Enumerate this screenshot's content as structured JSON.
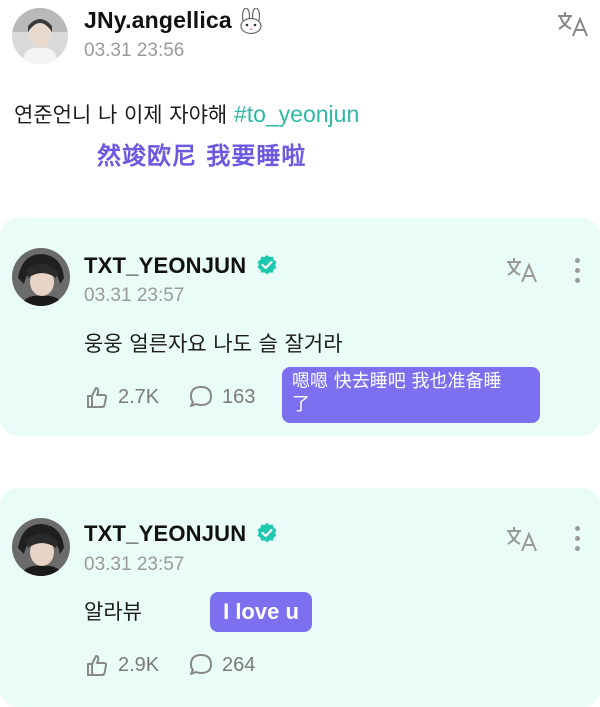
{
  "post": {
    "username": "JNy.angellica",
    "username_emoji": "rabbit",
    "time": "03.31 23:56",
    "text": "연준언니 나 이제 자야해 ",
    "hashtag": "#to_yeonjun",
    "translation_overlay": "然竣欧尼 我要睡啦"
  },
  "replies": [
    {
      "username": "TXT_YEONJUN",
      "verified": true,
      "time": "03.31 23:57",
      "text": "웅웅 얼른자요 나도 슬 잘거라",
      "likes": "2.7K",
      "comments": "163",
      "translation_overlay_line1": "嗯嗯 快去睡吧 我也准备睡",
      "translation_overlay_line2": "了"
    },
    {
      "username": "TXT_YEONJUN",
      "verified": true,
      "time": "03.31 23:57",
      "text": "알라뷰",
      "likes": "2.9K",
      "comments": "264",
      "translation_overlay": "I love u"
    }
  ],
  "icons": {
    "translate": "translate-icon",
    "more": "more-vertical-icon",
    "like": "like-icon",
    "comment": "comment-icon",
    "verified": "verified-badge-icon"
  },
  "colors": {
    "card_background": "#eafcf8",
    "hashtag": "#2fb9a5",
    "overlay": "#7c6ff0",
    "verified": "#1ec9b0"
  }
}
